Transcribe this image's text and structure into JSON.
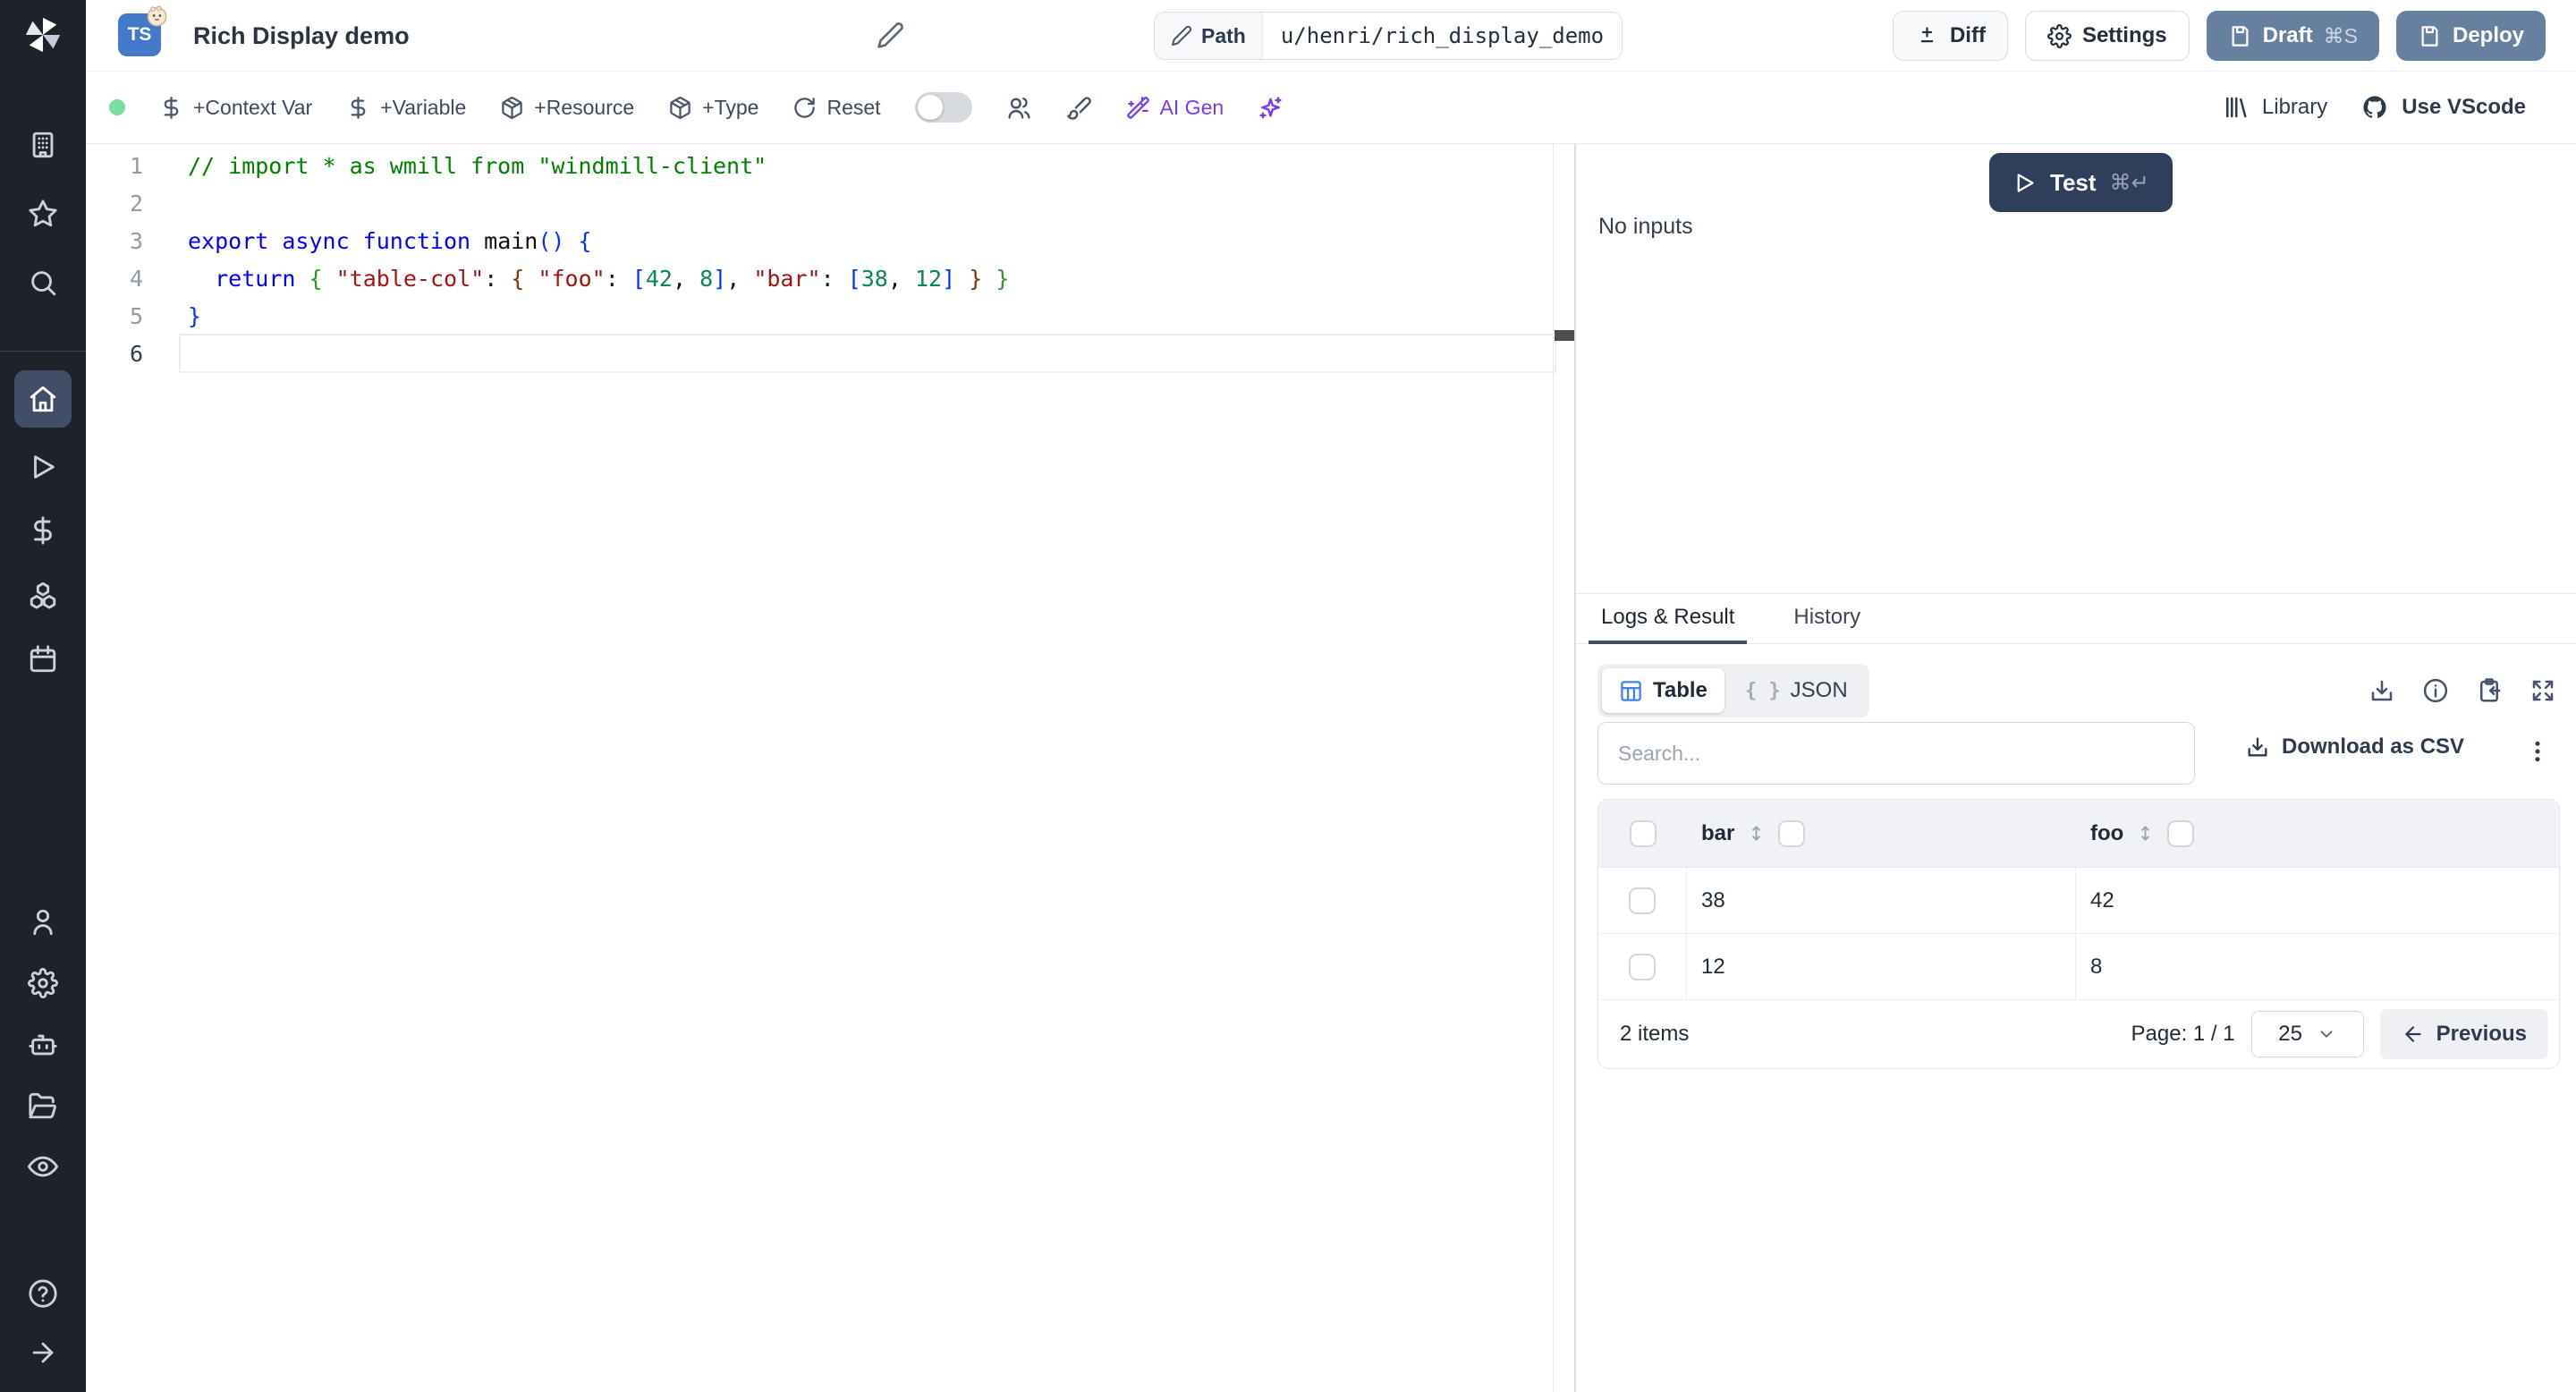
{
  "theme": {
    "sidebar_bg": "#1e222b",
    "sidebar_active_bg": "#414e68",
    "primary_btn": "#6780a0",
    "test_btn": "#2f3e5a",
    "ai_accent": "#7c3aed",
    "status_green": "#79dfa1",
    "table_icon_blue": "#3b82f6",
    "tab_underline": "#454e5e"
  },
  "icons": {
    "sidebar": [
      "windmill-logo",
      "building",
      "star",
      "search",
      "home",
      "play",
      "dollar",
      "boxes",
      "calendar",
      "user",
      "gear",
      "robot",
      "folder-open",
      "eye",
      "help-circle",
      "arrow-right"
    ],
    "header": [
      "typescript-badge",
      "bun-badge",
      "pencil",
      "diff",
      "gear",
      "save"
    ],
    "toolbar": [
      "dollar",
      "package",
      "rotate-cw",
      "toggle",
      "users",
      "paintbrush",
      "wand",
      "sparkles",
      "library",
      "github"
    ],
    "result": [
      "play",
      "table-grid",
      "braces",
      "download",
      "info",
      "clipboard-copy",
      "maximize",
      "kebab",
      "sort",
      "chevron-down",
      "arrow-left"
    ]
  },
  "header": {
    "lang_badge": "TS",
    "title": "Rich Display demo",
    "path_label": "Path",
    "path_value": "u/henri/rich_display_demo",
    "diff_label": "Diff",
    "settings_label": "Settings",
    "draft_label": "Draft",
    "draft_shortcut": "⌘S",
    "deploy_label": "Deploy"
  },
  "toolbar": {
    "add_context_var": "+Context Var",
    "add_variable": "+Variable",
    "add_resource": "+Resource",
    "add_type": "+Type",
    "reset": "Reset",
    "ai_gen": "AI Gen",
    "library": "Library",
    "use_vscode": "Use VScode"
  },
  "editor": {
    "lines": [
      {
        "num": "1",
        "tokens": [
          {
            "c": "comment",
            "t": "// import * as wmill from \"windmill-client\""
          }
        ]
      },
      {
        "num": "2",
        "tokens": []
      },
      {
        "num": "3",
        "tokens": [
          {
            "c": "kw",
            "t": "export async function "
          },
          {
            "c": "plain",
            "t": "main"
          },
          {
            "c": "b1",
            "t": "()"
          },
          {
            "c": "plain",
            "t": " "
          },
          {
            "c": "b1",
            "t": "{"
          }
        ]
      },
      {
        "num": "4",
        "tokens": [
          {
            "c": "plain",
            "t": "  "
          },
          {
            "c": "kw",
            "t": "return"
          },
          {
            "c": "plain",
            "t": " "
          },
          {
            "c": "b2",
            "t": "{"
          },
          {
            "c": "plain",
            "t": " "
          },
          {
            "c": "str",
            "t": "\"table-col\""
          },
          {
            "c": "plain",
            "t": ": "
          },
          {
            "c": "b3",
            "t": "{"
          },
          {
            "c": "plain",
            "t": " "
          },
          {
            "c": "str",
            "t": "\"foo\""
          },
          {
            "c": "plain",
            "t": ": "
          },
          {
            "c": "b1",
            "t": "["
          },
          {
            "c": "num",
            "t": "42"
          },
          {
            "c": "plain",
            "t": ", "
          },
          {
            "c": "num",
            "t": "8"
          },
          {
            "c": "b1",
            "t": "]"
          },
          {
            "c": "plain",
            "t": ", "
          },
          {
            "c": "str",
            "t": "\"bar\""
          },
          {
            "c": "plain",
            "t": ": "
          },
          {
            "c": "b1",
            "t": "["
          },
          {
            "c": "num",
            "t": "38"
          },
          {
            "c": "plain",
            "t": ", "
          },
          {
            "c": "num",
            "t": "12"
          },
          {
            "c": "b1",
            "t": "]"
          },
          {
            "c": "plain",
            "t": " "
          },
          {
            "c": "b3",
            "t": "}"
          },
          {
            "c": "plain",
            "t": " "
          },
          {
            "c": "b2",
            "t": "}"
          }
        ]
      },
      {
        "num": "5",
        "tokens": [
          {
            "c": "b1",
            "t": "}"
          }
        ]
      },
      {
        "num": "6",
        "active": true,
        "tokens": []
      }
    ]
  },
  "run_panel": {
    "test_label": "Test",
    "test_shortcut": "⌘↵",
    "no_inputs": "No inputs"
  },
  "result_panel": {
    "tabs": [
      "Logs & Result",
      "History"
    ],
    "active_tab": "Logs & Result",
    "view_toggle": {
      "table_label": "Table",
      "json_label": "JSON",
      "json_glyph": "{ }",
      "active": "Table"
    },
    "search_placeholder": "Search...",
    "download_csv": "Download as CSV",
    "table": {
      "columns": [
        "bar",
        "foo"
      ],
      "rows": [
        {
          "bar": "38",
          "foo": "42"
        },
        {
          "bar": "12",
          "foo": "8"
        }
      ],
      "items_label": "2 items",
      "page_label": "Page: 1 / 1",
      "page_size": "25",
      "prev_label": "Previous"
    }
  }
}
